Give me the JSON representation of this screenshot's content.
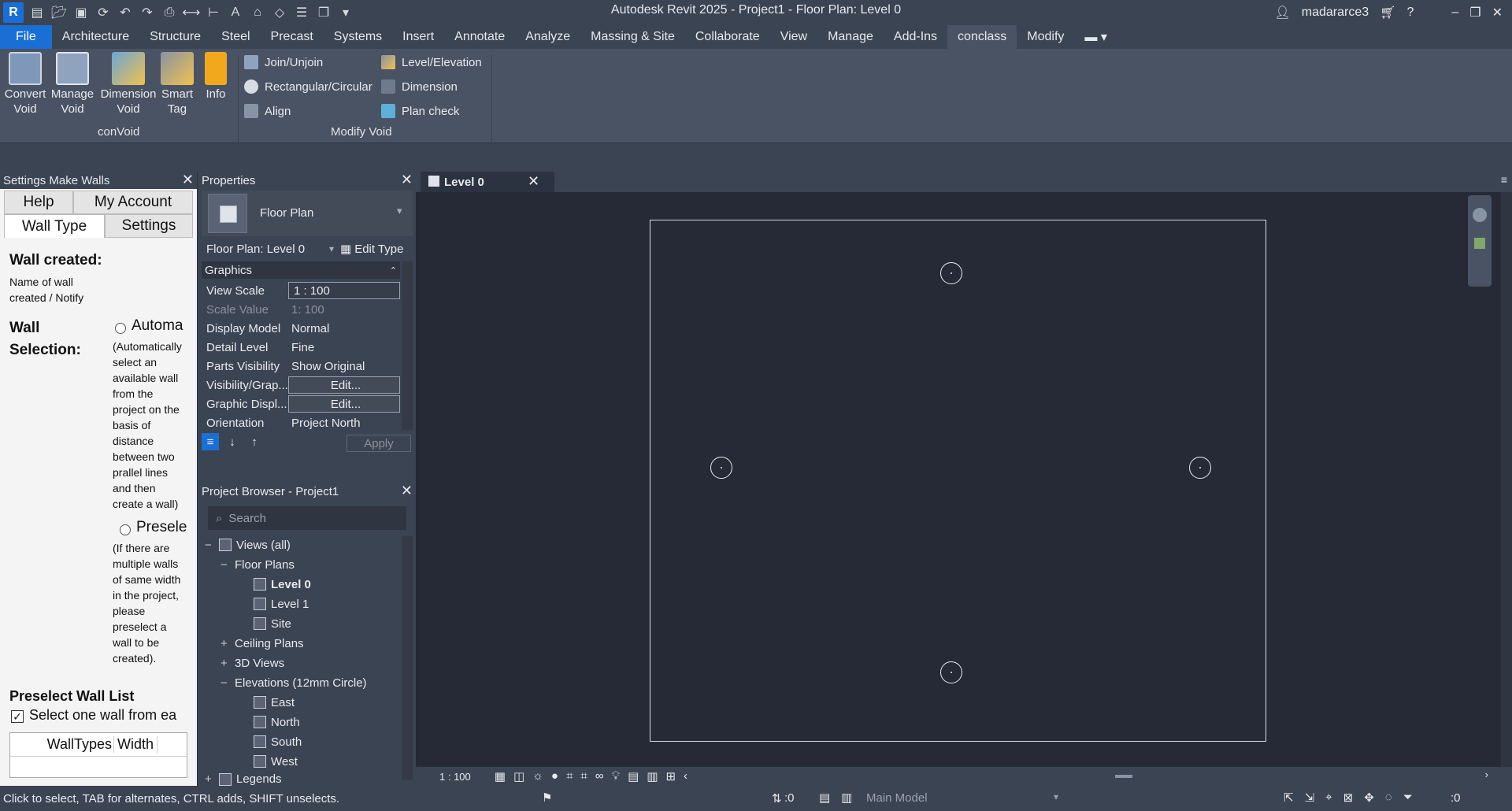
{
  "window": {
    "title": "Autodesk Revit 2025 - Project1 - Floor Plan: Level 0",
    "user": "madararce3"
  },
  "menu": {
    "tabs": [
      "File",
      "Architecture",
      "Structure",
      "Steel",
      "Precast",
      "Systems",
      "Insert",
      "Annotate",
      "Analyze",
      "Massing & Site",
      "Collaborate",
      "View",
      "Manage",
      "Add-Ins",
      "conclass",
      "Modify"
    ],
    "active": "conclass"
  },
  "ribbon": {
    "convoid_buttons": [
      {
        "label1": "Convert",
        "label2": "Void"
      },
      {
        "label1": "Manage",
        "label2": "Void"
      },
      {
        "label1": "Dimension",
        "label2": "Void"
      },
      {
        "label1": "Smart",
        "label2": "Tag"
      },
      {
        "label1": "Info",
        "label2": ""
      }
    ],
    "convoid_panel": "conVoid",
    "modify_void_left": [
      "Join/Unjoin",
      "Rectangular/Circular",
      "Align"
    ],
    "modify_void_right": [
      "Level/Elevation",
      "Dimension",
      "Plan check"
    ],
    "modify_void_panel": "Modify Void"
  },
  "settings_panel": {
    "title": "Settings Make Walls",
    "tabs": {
      "help": "Help",
      "account": "My Account",
      "wall_type": "Wall Type",
      "settings": "Settings"
    },
    "wall_created_heading": "Wall created:",
    "wall_created_desc1": "Name of wall",
    "wall_created_desc2": "created / Notify",
    "wall_selection_heading1": "Wall",
    "wall_selection_heading2": "Selection:",
    "option_auto_label": "Automa",
    "option_auto_desc": [
      "(Automatically",
      "select an",
      "available wall",
      "from the",
      "project on the",
      "basis of",
      "distance",
      "between two",
      "prallel lines",
      "and then",
      "create a wall)"
    ],
    "option_pre_label": "Presele",
    "option_pre_desc": [
      "(If there are",
      "multiple walls",
      "of same width",
      "in the project,",
      "please",
      "preselect a",
      "wall to be",
      "created)."
    ],
    "preselect_heading": "Preselect Wall List",
    "preselect_check": "Select one wall from ea",
    "list_headers": {
      "types": "WallTypes",
      "width": "Width"
    }
  },
  "properties": {
    "title": "Properties",
    "type_name": "Floor Plan",
    "instance_selector": "Floor Plan: Level 0",
    "edit_type": "Edit Type",
    "group": "Graphics",
    "rows": [
      {
        "k": "View Scale",
        "v": "1 : 100"
      },
      {
        "k": "Scale Value",
        "v": "1:  100"
      },
      {
        "k": "Display Model",
        "v": "Normal"
      },
      {
        "k": "Detail Level",
        "v": "Fine"
      },
      {
        "k": "Parts Visibility",
        "v": "Show Original"
      },
      {
        "k": "Visibility/Grap...",
        "v": "Edit..."
      },
      {
        "k": "Graphic Displ...",
        "v": "Edit..."
      },
      {
        "k": "Orientation",
        "v": "Project North"
      }
    ],
    "apply": "Apply"
  },
  "browser": {
    "title": "Project Browser - Project1",
    "search_placeholder": "Search",
    "items": {
      "views_all": "Views (all)",
      "floor_plans": "Floor Plans",
      "level0": "Level 0",
      "level1": "Level 1",
      "site": "Site",
      "ceiling_plans": "Ceiling Plans",
      "views3d": "3D Views",
      "elevations": "Elevations (12mm Circle)",
      "east": "East",
      "north": "North",
      "south": "South",
      "west": "West",
      "legends": "Legends"
    }
  },
  "view": {
    "tab": "Level 0",
    "scale": "1 : 100"
  },
  "status": {
    "hint": "Click to select, TAB for alternates, CTRL adds, SHIFT unselects.",
    "workset_count": ":0",
    "model": "Main Model",
    "filter_count": ":0"
  }
}
